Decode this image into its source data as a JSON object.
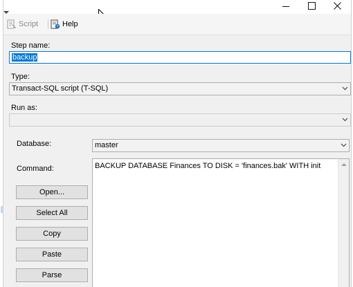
{
  "toolbar": {
    "script_label": "Script",
    "help_label": "Help"
  },
  "form": {
    "step_name_label": "Step name:",
    "step_name_value": "backup",
    "type_label": "Type:",
    "type_value": "Transact-SQL script (T-SQL)",
    "run_as_label": "Run as:",
    "run_as_value": "",
    "database_label": "Database:",
    "database_value": "master",
    "command_label": "Command:",
    "command_text": "BACKUP DATABASE Finances TO DISK = 'finances.bak' WITH init"
  },
  "buttons": {
    "open": "Open...",
    "select_all": "Select All",
    "copy": "Copy",
    "paste": "Paste",
    "parse": "Parse"
  },
  "icons": {
    "script": "script-icon",
    "help": "help-icon",
    "minimize": "minimize-icon",
    "maximize": "maximize-icon",
    "close": "close-icon",
    "dropdown": "chevron-down-icon"
  },
  "colors": {
    "selection": "#0078d7",
    "focus_border": "#0078d7",
    "button_face": "#e1e1e1",
    "dialog_background": "#f0f0f0"
  }
}
